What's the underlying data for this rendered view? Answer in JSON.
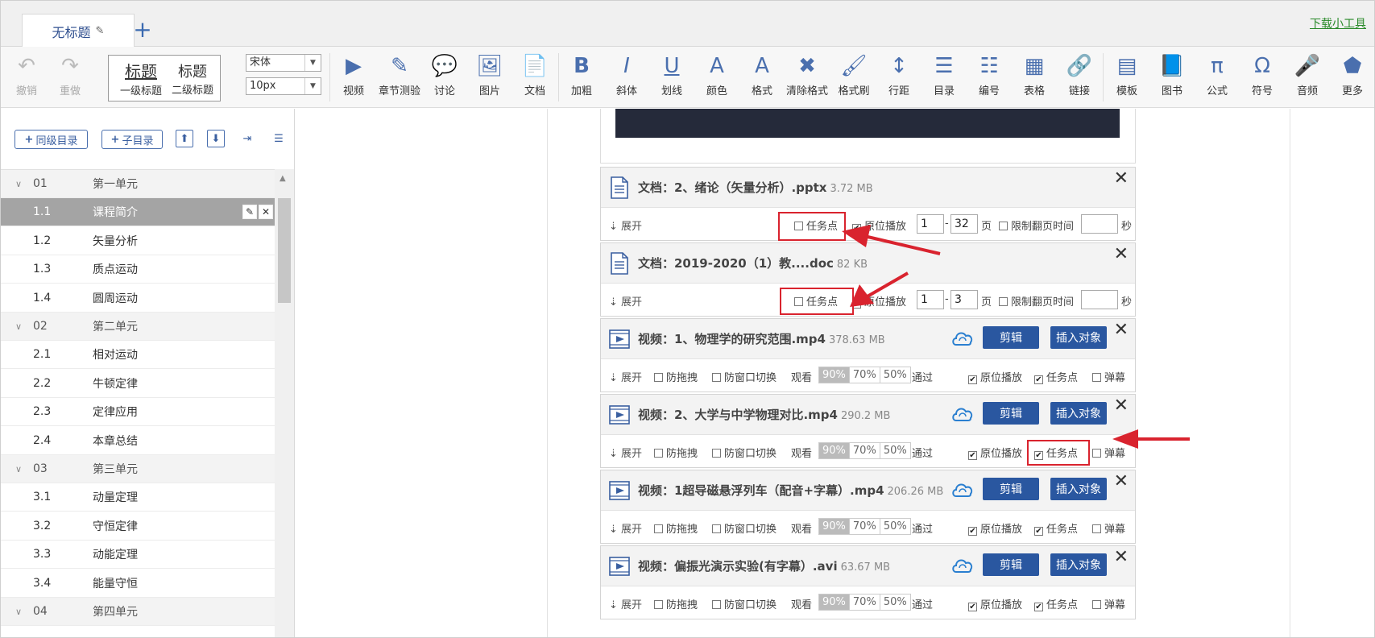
{
  "tabs": {
    "doc_title": "无标题",
    "download_link": "下载小工具"
  },
  "toolbar": {
    "undo": "撤销",
    "redo": "重做",
    "heading1_big": "标题",
    "heading1_small": "一级标题",
    "heading2_big": "标题",
    "heading2_small": "二级标题",
    "font_family": "宋体",
    "font_size": "10px",
    "buttons": [
      "视频",
      "章节测验",
      "讨论",
      "图片",
      "文档",
      "加粗",
      "斜体",
      "划线",
      "颜色",
      "格式",
      "清除格式",
      "格式刷",
      "行距",
      "目录",
      "编号",
      "表格",
      "链接",
      "模板",
      "图书",
      "公式",
      "符号",
      "音频",
      "更多"
    ]
  },
  "sidebar": {
    "add_sibling": "同级目录",
    "add_child": "子目录",
    "rows": [
      {
        "num": "01",
        "title": "第一单元",
        "type": "unit"
      },
      {
        "num": "1.1",
        "title": "课程简介",
        "type": "selected"
      },
      {
        "num": "1.2",
        "title": "矢量分析",
        "type": "item"
      },
      {
        "num": "1.3",
        "title": "质点运动",
        "type": "item"
      },
      {
        "num": "1.4",
        "title": "圆周运动",
        "type": "item"
      },
      {
        "num": "02",
        "title": "第二单元",
        "type": "unit"
      },
      {
        "num": "2.1",
        "title": "相对运动",
        "type": "item"
      },
      {
        "num": "2.2",
        "title": "牛顿定律",
        "type": "item"
      },
      {
        "num": "2.3",
        "title": "定律应用",
        "type": "item"
      },
      {
        "num": "2.4",
        "title": "本章总结",
        "type": "item"
      },
      {
        "num": "03",
        "title": "第三单元",
        "type": "unit"
      },
      {
        "num": "3.1",
        "title": "动量定理",
        "type": "item"
      },
      {
        "num": "3.2",
        "title": "守恒定律",
        "type": "item"
      },
      {
        "num": "3.3",
        "title": "动能定理",
        "type": "item"
      },
      {
        "num": "3.4",
        "title": "能量守恒",
        "type": "item"
      },
      {
        "num": "04",
        "title": "第四单元",
        "type": "unit"
      }
    ]
  },
  "common": {
    "expand": "展开",
    "task_point": "任务点",
    "in_place_play": "原位播放",
    "page_unit": "页",
    "limit_time": "限制翻页时间",
    "sec_unit": "秒",
    "anti_drag": "防拖拽",
    "anti_switch": "防窗口切换",
    "watch": "观看",
    "pass": "通过",
    "popup": "弹幕",
    "edit_btn": "剪辑",
    "insert_btn": "插入对象",
    "pct": [
      "90%",
      "70%",
      "50%"
    ]
  },
  "cards": [
    {
      "kind": "doc",
      "title": "文档：2、绪论（矢量分析）.pptx",
      "size": "3.72 MB",
      "page_from": "1",
      "page_to": "32"
    },
    {
      "kind": "doc",
      "title": "文档：2019-2020（1）教....doc",
      "size": "82 KB",
      "page_from": "1",
      "page_to": "3"
    },
    {
      "kind": "video",
      "title": "视频：1、物理学的研究范围.mp4",
      "size": "378.63 MB"
    },
    {
      "kind": "video",
      "title": "视频：2、大学与中学物理对比.mp4",
      "size": "290.2 MB"
    },
    {
      "kind": "video",
      "title": "视频：1超导磁悬浮列车（配音+字幕）.mp4",
      "size": "206.26 MB"
    },
    {
      "kind": "video",
      "title": "视频：偏振光演示实验(有字幕）.avi",
      "size": "63.67 MB"
    }
  ],
  "colors": {
    "accent": "#2a57a0",
    "annotation": "#d9232e",
    "selected_row": "#a4a4a4"
  }
}
